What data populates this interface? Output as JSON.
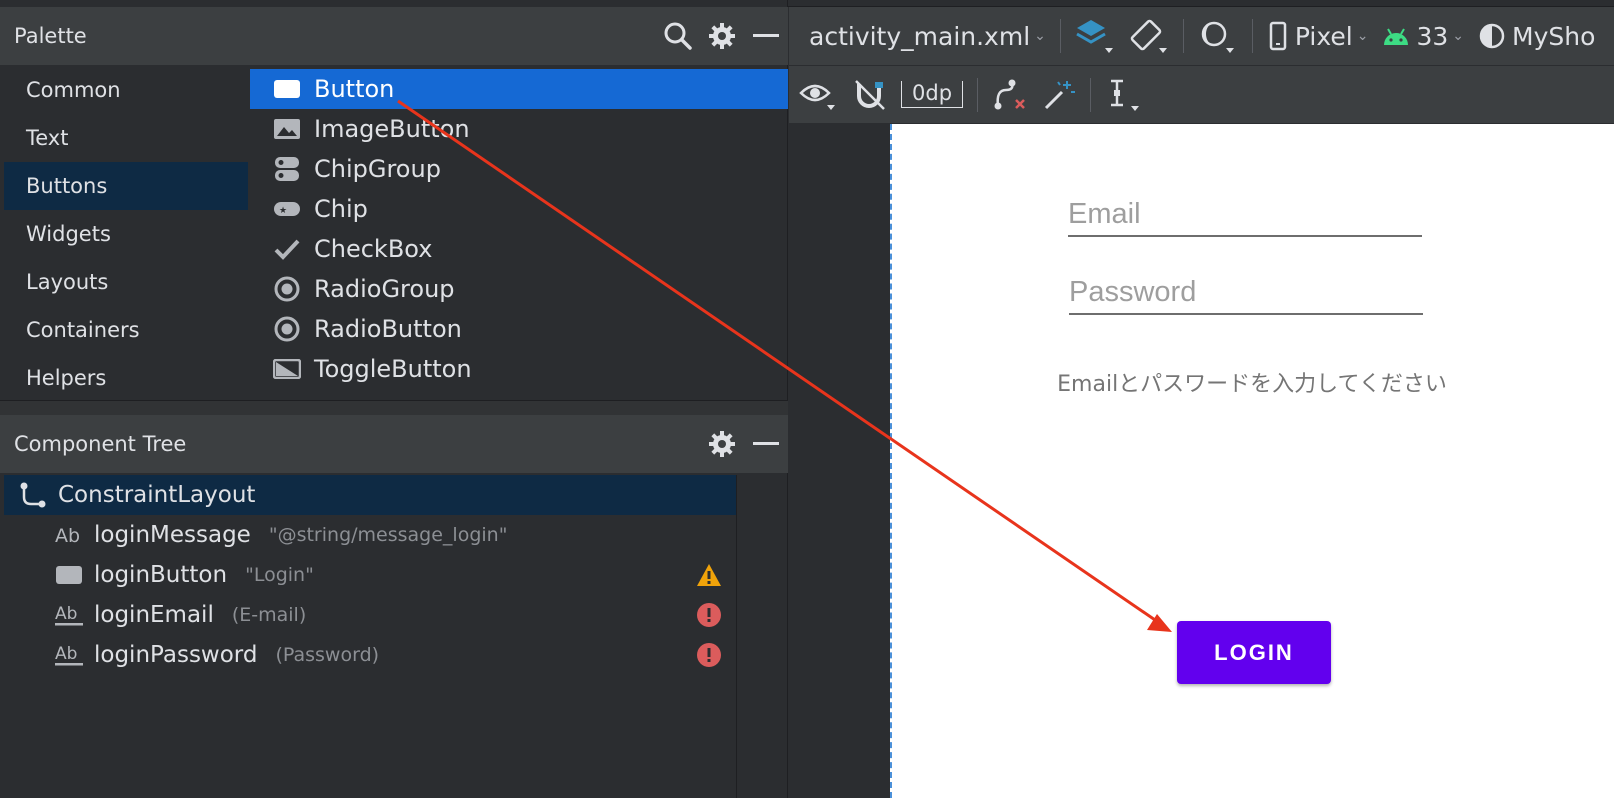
{
  "palette": {
    "title": "Palette",
    "categories": [
      {
        "label": "Common"
      },
      {
        "label": "Text"
      },
      {
        "label": "Buttons"
      },
      {
        "label": "Widgets"
      },
      {
        "label": "Layouts"
      },
      {
        "label": "Containers"
      },
      {
        "label": "Helpers"
      }
    ],
    "selected_category": "Buttons",
    "items": [
      {
        "label": "Button"
      },
      {
        "label": "ImageButton"
      },
      {
        "label": "ChipGroup"
      },
      {
        "label": "Chip"
      },
      {
        "label": "CheckBox"
      },
      {
        "label": "RadioGroup"
      },
      {
        "label": "RadioButton"
      },
      {
        "label": "ToggleButton"
      }
    ],
    "selected_item": "Button"
  },
  "tree": {
    "title": "Component Tree",
    "root": {
      "label": "ConstraintLayout"
    },
    "children": [
      {
        "id": "loginMessage",
        "detail": "\"@string/message_login\"",
        "status": ""
      },
      {
        "id": "loginButton",
        "detail": "\"Login\"",
        "status": "warning"
      },
      {
        "id": "loginEmail",
        "detail": "(E-mail)",
        "status": "error"
      },
      {
        "id": "loginPassword",
        "detail": "(Password)",
        "status": "error"
      }
    ]
  },
  "toolbar": {
    "file": "activity_main.xml",
    "device": "Pixel",
    "api": "33",
    "theme": "MySho",
    "margin": "0dp"
  },
  "preview": {
    "email_hint": "Email",
    "password_hint": "Password",
    "message": "Emailとパスワードを入力してください",
    "login_label": "LOGIN"
  },
  "colors": {
    "selection": "#1569d4",
    "category_selected": "#0e2a44",
    "button": "#6200ee",
    "warning": "#f0a30a",
    "error": "#db5c5c",
    "arrow": "#e8341c",
    "android_green": "#3ddc84",
    "layers_blue": "#3592c4"
  }
}
